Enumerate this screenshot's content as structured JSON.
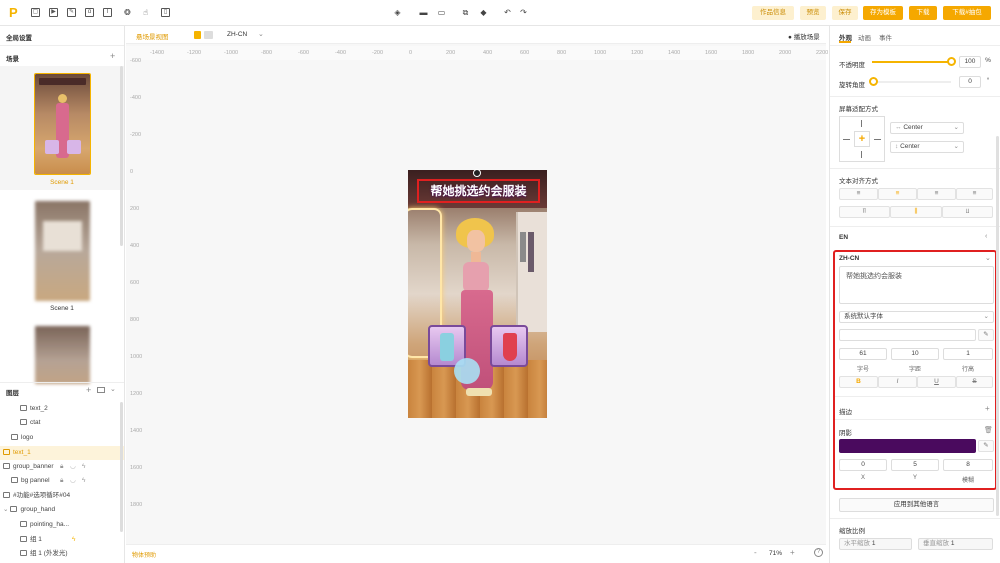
{
  "topbar": {
    "logo": "P",
    "center_tools": [
      "layers-icon",
      "folder-icon",
      "folder-open-icon",
      "copy-icon",
      "paste-icon",
      "undo-icon",
      "redo-icon"
    ],
    "buttons": [
      {
        "label": "作品信息",
        "style": "light"
      },
      {
        "label": "预览",
        "style": "light"
      },
      {
        "label": "保存",
        "style": "light"
      },
      {
        "label": "存为模板",
        "style": "dark"
      },
      {
        "label": "下载",
        "style": "dark"
      },
      {
        "label": "下载#抽包",
        "style": "dark"
      }
    ]
  },
  "left": {
    "global_settings": "全局设置",
    "scenes_title": "场景",
    "add": "+",
    "scenes": [
      {
        "label": "Scene 1"
      },
      {
        "label": "Scene 1"
      }
    ],
    "layers_title": "图层",
    "layers": [
      {
        "label": "text_2",
        "icon": "text"
      },
      {
        "label": "ctat",
        "icon": "image"
      },
      {
        "label": "logo",
        "icon": "image"
      },
      {
        "label": "text_1",
        "icon": "text"
      },
      {
        "label": "group_banner",
        "icon": "folder"
      },
      {
        "label": "bg pannel",
        "icon": "image"
      },
      {
        "label": "#功能#选项循环#04",
        "icon": "folder"
      },
      {
        "label": "group_hand",
        "icon": "folder"
      },
      {
        "label": "pointing_ha...",
        "icon": "image"
      },
      {
        "label": "组 1",
        "icon": "image"
      },
      {
        "label": "组 1 (外发光)",
        "icon": "image"
      }
    ]
  },
  "canvasbar": {
    "scene_view": "悬场景视图",
    "lang": "ZH-CN",
    "play": "播放场景"
  },
  "ruler": {
    "top": [
      "-1400",
      "-1200",
      "-1000",
      "-800",
      "-600",
      "-400",
      "-200",
      "0",
      "200",
      "400",
      "600",
      "800",
      "1000",
      "1200",
      "1400",
      "1600",
      "1800",
      "2000",
      "2200"
    ],
    "left": [
      "-600",
      "-400",
      "-200",
      "0",
      "200",
      "400",
      "600",
      "800",
      "1000",
      "1200",
      "1400",
      "1600",
      "1800"
    ]
  },
  "game": {
    "banner_text": "帮她挑选约会服装"
  },
  "bottombar": {
    "hint": "物体预助",
    "zoom": "71%",
    "minus": "-",
    "plus": "+"
  },
  "right": {
    "tabs": [
      "外观",
      "动画",
      "事件"
    ],
    "opacity_label": "不透明度",
    "opacity_value": "100",
    "opacity_unit": "%",
    "opacity_fraction": 1.0,
    "rotation_label": "旋转角度",
    "rotation_value": "0",
    "rotation_unit": "°",
    "screen_adapt_title": "屏幕适配方式",
    "h_align": "Center",
    "v_align": "Center",
    "text_align_title": "文本对齐方式",
    "lang_en": "EN",
    "lang_zh": "ZH-CN",
    "text_content": "帮她挑选约会服装",
    "font_select": "系统默认字体",
    "size_value": "61",
    "spacing_value": "10",
    "lineheight_value": "1",
    "size_label": "字号",
    "spacing_label": "字距",
    "lineheight_label": "行高",
    "stroke_label": "描边",
    "shadow_label": "阴影",
    "shadow_color": "#4a0a5e",
    "shadow_x": "0",
    "shadow_y": "5",
    "shadow_blur": "8",
    "x_label": "X",
    "y_label": "Y",
    "blur_label": "模糊",
    "apply_all": "应用到其他语言",
    "scale_title": "缩放比例",
    "hscale_label": "水平缩放",
    "hscale_value": "1",
    "vscale_label": "垂直缩放",
    "vscale_value": "1",
    "style_buttons": [
      "B",
      "I",
      "U",
      "S"
    ]
  },
  "colors": {
    "accent": "#f5a800",
    "highlight": "#e02020",
    "banner_bg": "#5a3a3a"
  }
}
